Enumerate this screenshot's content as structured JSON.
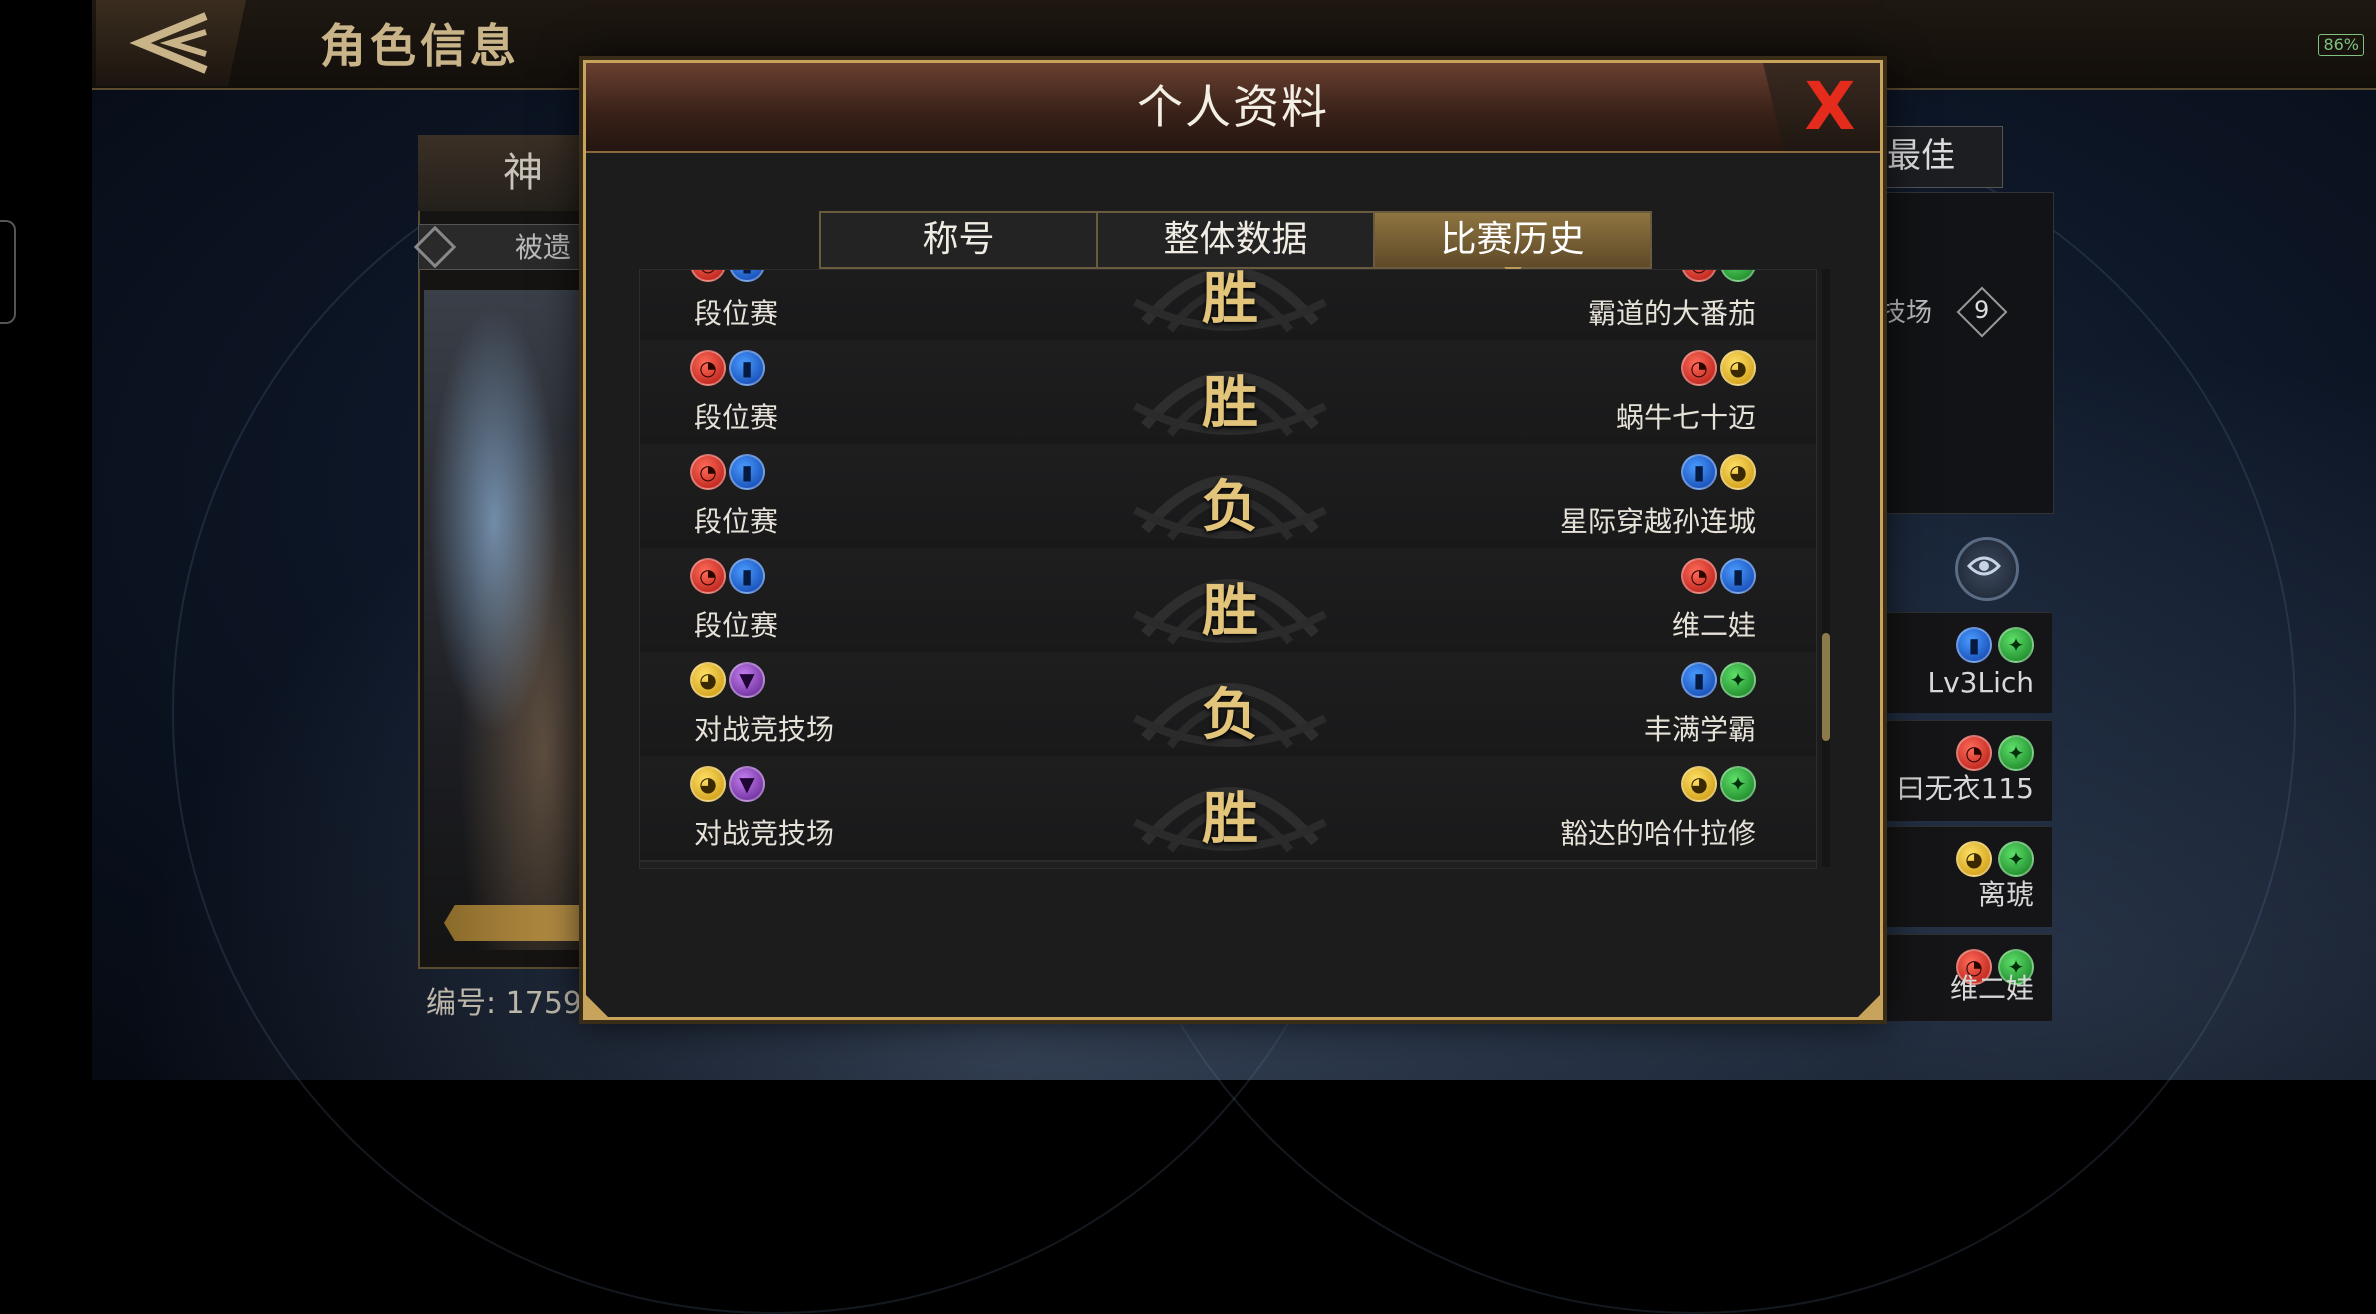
{
  "header": {
    "title": "角色信息",
    "battery": "86%"
  },
  "left_card": {
    "tab_label": "神",
    "sub_label": "被遗",
    "id_label": "编号: 1759"
  },
  "right_side": {
    "tab_label": "最佳",
    "arena_label": "技场",
    "arena_count": "9",
    "rows": [
      {
        "name": "Lv3Lich",
        "icons": [
          "blue",
          "green"
        ]
      },
      {
        "name": "曰无衣115",
        "icons": [
          "red",
          "green"
        ]
      },
      {
        "name": "离琥",
        "icons": [
          "yellow",
          "green"
        ]
      },
      {
        "name": "维二娃",
        "icons": [
          "red",
          "green"
        ]
      }
    ]
  },
  "dialog": {
    "title": "个人资料",
    "close_label": "X",
    "tabs": [
      {
        "label": "称号",
        "active": false
      },
      {
        "label": "整体数据",
        "active": false
      },
      {
        "label": "比赛历史",
        "active": true
      }
    ]
  },
  "matches": [
    {
      "mode": "段位赛",
      "result": "胜",
      "self_icons": [
        "red",
        "blue"
      ],
      "opponent": "霸道的大番茄",
      "opp_icons": [
        "red",
        "green"
      ]
    },
    {
      "mode": "段位赛",
      "result": "胜",
      "self_icons": [
        "red",
        "blue"
      ],
      "opponent": "蜗牛七十迈",
      "opp_icons": [
        "red",
        "yellow"
      ]
    },
    {
      "mode": "段位赛",
      "result": "负",
      "self_icons": [
        "red",
        "blue"
      ],
      "opponent": "星际穿越孙连城",
      "opp_icons": [
        "blue",
        "yellow"
      ]
    },
    {
      "mode": "段位赛",
      "result": "胜",
      "self_icons": [
        "red",
        "blue"
      ],
      "opponent": "维二娃",
      "opp_icons": [
        "red",
        "blue"
      ]
    },
    {
      "mode": "对战竞技场",
      "result": "负",
      "self_icons": [
        "yellow",
        "purple"
      ],
      "opponent": "丰满学霸",
      "opp_icons": [
        "blue",
        "green"
      ]
    },
    {
      "mode": "对战竞技场",
      "result": "胜",
      "self_icons": [
        "yellow",
        "purple"
      ],
      "opponent": "豁达的哈什拉修",
      "opp_icons": [
        "yellow",
        "green"
      ]
    }
  ],
  "icon_glyphs": {
    "red": "fire-class-icon",
    "blue": "book-class-icon",
    "green": "nature-class-icon",
    "yellow": "beast-class-icon",
    "purple": "anvil-class-icon"
  },
  "colors": {
    "accent_gold": "#c8a35c",
    "result_text": "#e2c47a",
    "close_red": "#e52c1c"
  }
}
